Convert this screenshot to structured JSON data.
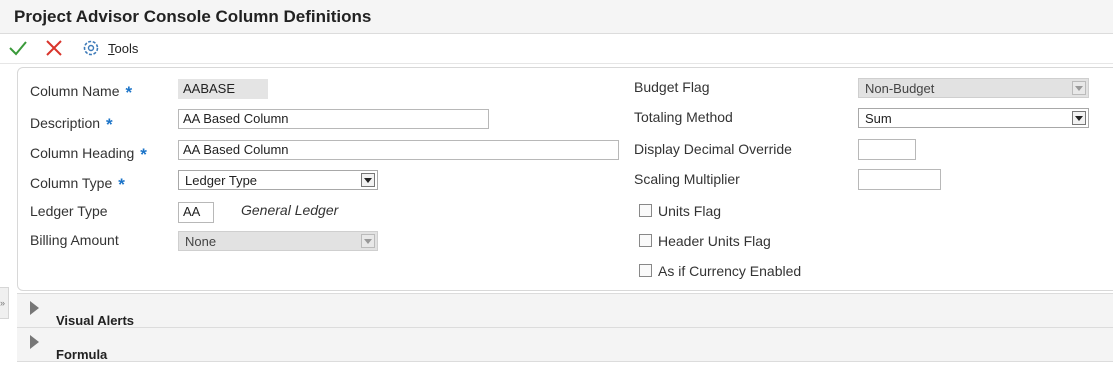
{
  "window": {
    "title": "Project Advisor Console Column Definitions"
  },
  "toolbar": {
    "ok_icon": "check-icon",
    "cancel_icon": "close-icon",
    "tools_prefix": "T",
    "tools_rest": "ools"
  },
  "form": {
    "column_name": {
      "label": "Column Name",
      "required": "*",
      "value": "AABASE"
    },
    "description": {
      "label": "Description",
      "required": "*",
      "value": "AA Based Column"
    },
    "column_heading": {
      "label": "Column Heading",
      "required": "*",
      "value": "AA Based Column"
    },
    "column_type": {
      "label": "Column Type",
      "required": "*",
      "value": "Ledger Type"
    },
    "ledger_type": {
      "label": "Ledger Type",
      "value": "AA",
      "description": "General Ledger"
    },
    "billing_amount": {
      "label": "Billing Amount",
      "value": "None"
    },
    "budget_flag": {
      "label": "Budget Flag",
      "value": "Non-Budget"
    },
    "totaling_method": {
      "label": "Totaling Method",
      "value": "Sum"
    },
    "display_decimal_override": {
      "label": "Display Decimal Override",
      "value": ""
    },
    "scaling_multiplier": {
      "label": "Scaling Multiplier",
      "value": ""
    },
    "units_flag": {
      "label": "Units Flag",
      "checked": false
    },
    "header_units_flag": {
      "label": "Header Units Flag",
      "checked": false
    },
    "as_if_currency_enabled": {
      "label": "As if Currency Enabled",
      "checked": false
    }
  },
  "sections": [
    {
      "title": "Visual Alerts",
      "expanded": false
    },
    {
      "title": "Formula",
      "expanded": false
    }
  ],
  "colors": {
    "accent": "#1a73c8",
    "ok": "#3a9a3a",
    "cancel": "#d9342b"
  }
}
